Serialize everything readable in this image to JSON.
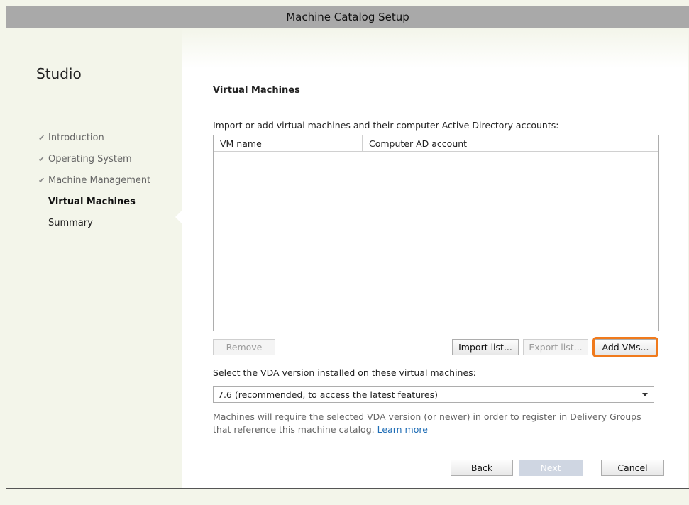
{
  "window": {
    "title": "Machine Catalog Setup"
  },
  "sidebar": {
    "title": "Studio",
    "steps": [
      {
        "label": "Introduction",
        "state": "done",
        "check": "✔"
      },
      {
        "label": "Operating System",
        "state": "done",
        "check": "✔"
      },
      {
        "label": "Machine Management",
        "state": "done",
        "check": "✔"
      },
      {
        "label": "Virtual Machines",
        "state": "current",
        "check": ""
      },
      {
        "label": "Summary",
        "state": "pending",
        "check": ""
      }
    ]
  },
  "main": {
    "section_title": "Virtual Machines",
    "instructions": "Import or add virtual machines and their computer Active Directory accounts:",
    "table": {
      "columns": [
        "VM name",
        "Computer AD account"
      ],
      "rows": []
    },
    "buttons": {
      "remove": "Remove",
      "import_list": "Import list...",
      "export_list": "Export list...",
      "add_vms": "Add VMs..."
    },
    "vda": {
      "label": "Select the VDA version installed on these virtual machines:",
      "selected": "7.6 (recommended, to access the latest features)"
    },
    "info_text": "Machines will require the selected VDA version (or newer) in order to register in Delivery Groups that reference this machine catalog.",
    "learn_more": "Learn more"
  },
  "footer": {
    "back": "Back",
    "next": "Next",
    "cancel": "Cancel"
  },
  "colors": {
    "highlight": "#f07a1c",
    "link": "#1f6db5",
    "titlebar": "#a9a9a9"
  }
}
